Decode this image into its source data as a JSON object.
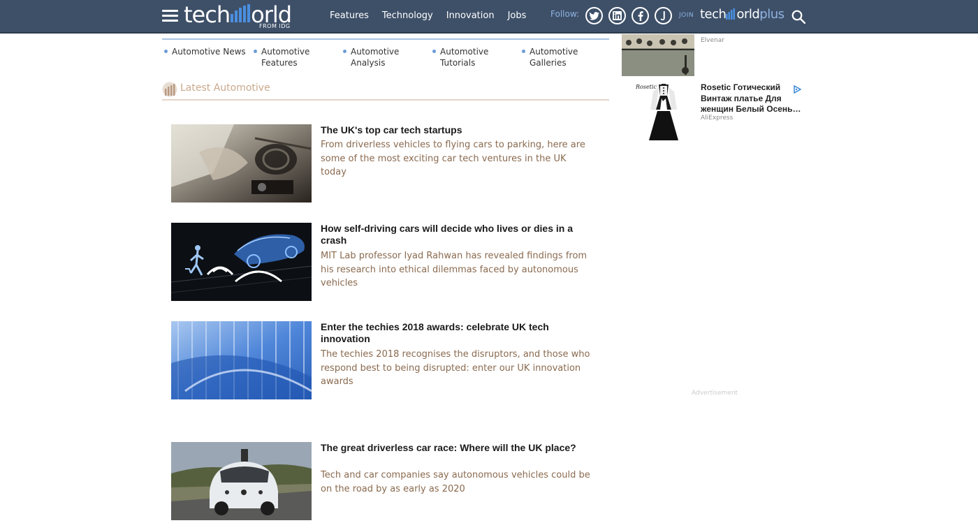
{
  "header": {
    "logo_main": "tech",
    "logo_end": "orld",
    "logo_sub": "FROM IDG",
    "nav": [
      "Features",
      "Technology",
      "Innovation",
      "Jobs"
    ],
    "follow_label": "Follow:",
    "social": [
      "twitter-icon",
      "linkedin-icon",
      "facebook-icon",
      "j-icon"
    ],
    "join_label": "JOIN",
    "plus_logo_main": "tech",
    "plus_logo_end": "orld",
    "plus_logo_plus": "plus"
  },
  "subnav": [
    {
      "label": "Automotive News"
    },
    {
      "label": "Automotive Features"
    },
    {
      "label": "Automotive Analysis"
    },
    {
      "label": "Automotive Tutorials"
    },
    {
      "label": "Automotive Galleries"
    }
  ],
  "section": {
    "title": "Latest Automotive"
  },
  "articles": [
    {
      "title": "The UK's top car tech startups",
      "desc": "From driverless vehicles to flying cars to parking, here are some of the most exciting car tech ventures in the UK today"
    },
    {
      "title": "How self-driving cars will decide who lives or dies in a crash",
      "desc": "MIT Lab professor Iyad Rahwan has revealed findings from his research into ethical dilemmas faced by autonomous vehicles"
    },
    {
      "title": "Enter the techies 2018 awards: celebrate UK tech innovation",
      "desc": "The techies 2018 recognises the disruptors, and those who respond best to being disrupted: enter our UK innovation awards"
    },
    {
      "title": "The great driverless car race: Where will the UK place?",
      "desc": "Tech and car companies say autonomous vehicles could be on the road by as early as 2020"
    }
  ],
  "sidebar": {
    "ad1": {
      "source": "Elvenar"
    },
    "ad2": {
      "brand": "Rosetic",
      "title": "Rosetic Готический Винтаж платье Для женщин Белый Осень…",
      "source": "AliExpress"
    },
    "advert_label": "Advertisement"
  },
  "colors": {
    "header_bg": "#3e5068",
    "accent_blue": "#6b9bd8",
    "desc_text": "#8a6a4f",
    "section_title": "#c9a98c"
  }
}
